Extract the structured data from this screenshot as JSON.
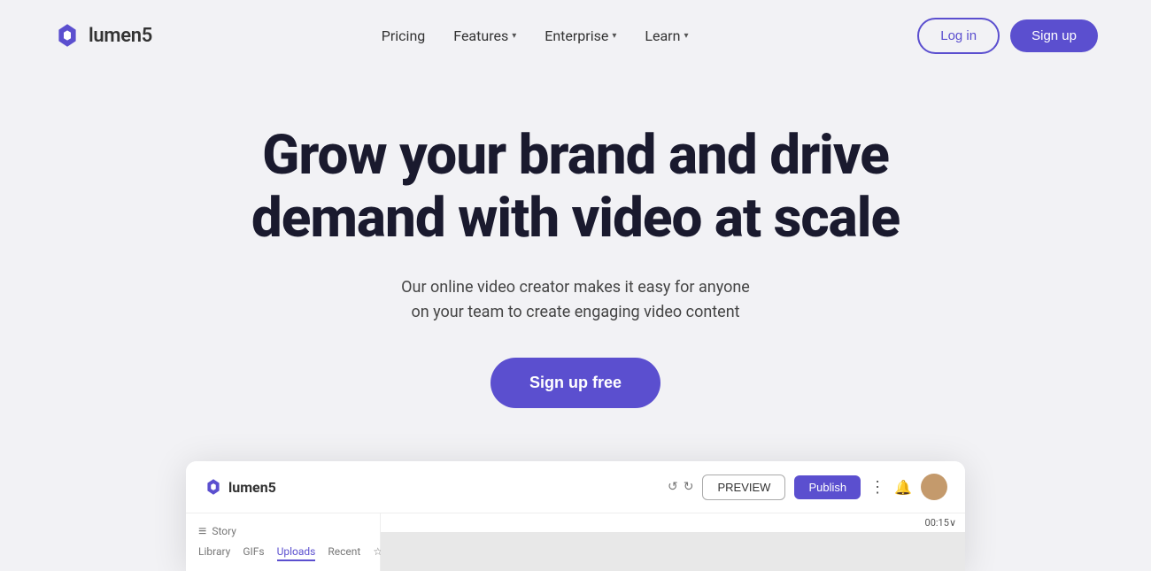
{
  "brand": {
    "name": "lumen5",
    "logo_color": "#5b4fcf"
  },
  "nav": {
    "links": [
      {
        "id": "pricing",
        "label": "Pricing",
        "has_dropdown": false
      },
      {
        "id": "features",
        "label": "Features",
        "has_dropdown": true
      },
      {
        "id": "enterprise",
        "label": "Enterprise",
        "has_dropdown": true
      },
      {
        "id": "learn",
        "label": "Learn",
        "has_dropdown": true
      }
    ],
    "login_label": "Log in",
    "signup_label": "Sign up"
  },
  "hero": {
    "title_line1": "Grow your brand and drive",
    "title_line2": "demand with video at scale",
    "subtitle": "Our online video creator makes it easy for anyone on your team to create engaging video content",
    "cta_label": "Sign up free"
  },
  "app_preview": {
    "logo_text": "lumen5",
    "preview_label": "PREVIEW",
    "publish_label": "Publish",
    "story_label": "Story",
    "tabs": [
      "Library",
      "GIFs",
      "Uploads",
      "Recent"
    ],
    "active_tab": "Uploads",
    "timer": "00:15"
  }
}
